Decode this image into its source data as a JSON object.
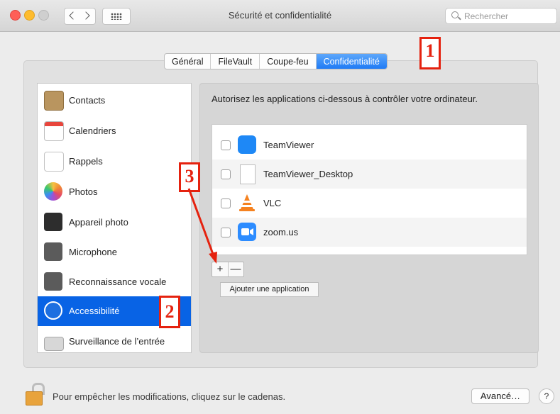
{
  "window": {
    "title": "Sécurité et confidentialité",
    "search_placeholder": "Rechercher"
  },
  "tabs": [
    {
      "label": "Général",
      "active": false
    },
    {
      "label": "FileVault",
      "active": false
    },
    {
      "label": "Coupe-feu",
      "active": false
    },
    {
      "label": "Confidentialité",
      "active": true
    }
  ],
  "sidebar": {
    "items": [
      {
        "label": "Contacts",
        "icon": "contacts-icon"
      },
      {
        "label": "Calendriers",
        "icon": "calendar-icon"
      },
      {
        "label": "Rappels",
        "icon": "reminders-icon"
      },
      {
        "label": "Photos",
        "icon": "photos-icon"
      },
      {
        "label": "Appareil photo",
        "icon": "camera-icon"
      },
      {
        "label": "Microphone",
        "icon": "microphone-icon"
      },
      {
        "label": "Reconnaissance vocale",
        "icon": "speech-recognition-icon"
      },
      {
        "label": "Accessibilité",
        "icon": "accessibility-icon",
        "selected": true
      },
      {
        "label": "Surveillance de l’entrée",
        "icon": "keyboard-icon"
      }
    ]
  },
  "main": {
    "description": "Autorisez les applications ci-dessous à contrôler votre ordinateur.",
    "apps": [
      {
        "name": "TeamViewer",
        "checked": false,
        "icon": "teamviewer-icon"
      },
      {
        "name": "TeamViewer_Desktop",
        "checked": false,
        "icon": "document-icon"
      },
      {
        "name": "VLC",
        "checked": false,
        "icon": "vlc-icon"
      },
      {
        "name": "zoom.us",
        "checked": false,
        "icon": "zoom-icon"
      }
    ],
    "add_label": "+",
    "remove_label": "—",
    "tooltip": "Ajouter une application"
  },
  "annotations": {
    "marker1": "1",
    "marker2": "2",
    "marker3": "3"
  },
  "footer": {
    "lock_text": "Pour empêcher les modifications, cliquez sur le cadenas.",
    "advanced_label": "Avancé…",
    "help_label": "?"
  },
  "colors": {
    "selection": "#0863e5",
    "annotation": "#e5220f",
    "tab_active": "#1f7bf5"
  }
}
